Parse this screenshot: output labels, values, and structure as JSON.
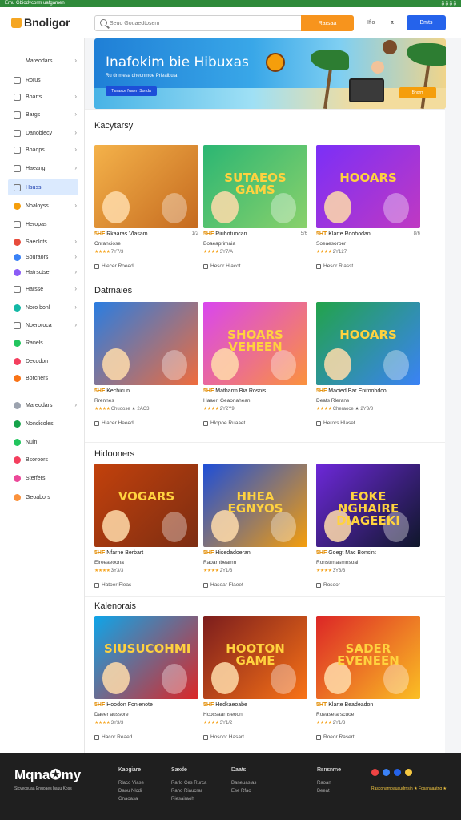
{
  "topstrip": {
    "left": "Emu Gbiodvcorm uafgamen",
    "right": "ᵹ ᵹ ᵹ ᵹ"
  },
  "header": {
    "logo": "Bnoligor",
    "search_placeholder": "Seuo Gouaedtosem",
    "search_button": "Rarsaa",
    "link_help": "Ifio",
    "link_bell": "ᴥ",
    "signin": "Bmts"
  },
  "sidebar": {
    "items": [
      {
        "label": "Mareodars",
        "icon": "none",
        "chev": "›"
      },
      {
        "label": "Rorus",
        "icon": "grid-icon",
        "chev": ""
      },
      {
        "label": "Boarts",
        "icon": "doc-icon",
        "chev": "›"
      },
      {
        "label": "Bargs",
        "icon": "tag-icon",
        "chev": "›"
      },
      {
        "label": "Danoblecy",
        "icon": "list-icon",
        "chev": "›"
      },
      {
        "label": "Boaops",
        "icon": "box-icon",
        "chev": "›"
      },
      {
        "label": "Haeang",
        "icon": "chart-icon",
        "chev": "›"
      },
      {
        "label": "Hsuss",
        "icon": "home-icon",
        "chev": "",
        "active": true
      },
      {
        "label": "Noaloyss",
        "icon": "puzzle-icon",
        "chev": "›"
      },
      {
        "label": "Heropas",
        "icon": "card-icon",
        "chev": ""
      },
      {
        "label": "Saeclots",
        "icon": "red-dot-icon",
        "chev": "›"
      },
      {
        "label": "Souraors",
        "icon": "blue-dot-icon",
        "chev": "›"
      },
      {
        "label": "Hatrsctse",
        "icon": "purple-dot-icon",
        "chev": "›"
      },
      {
        "label": "Harsse",
        "icon": "grid-icon",
        "chev": "›"
      },
      {
        "label": "Noro bonl",
        "icon": "globe-icon",
        "chev": "›"
      },
      {
        "label": "Noeroroca",
        "icon": "list-icon",
        "chev": "›"
      },
      {
        "label": "Ranels",
        "icon": "green-dot-icon",
        "chev": ""
      },
      {
        "label": "Decodon",
        "icon": "multi-icon",
        "chev": ""
      },
      {
        "label": "Borcners",
        "icon": "orange-dot-icon",
        "chev": ""
      },
      {
        "label": "Mareodars",
        "icon": "gray-dot-icon",
        "chev": "›"
      },
      {
        "label": "Nondicoles",
        "icon": "green-ring-icon",
        "chev": ""
      },
      {
        "label": "Nuin",
        "icon": "green-dot-icon",
        "chev": ""
      },
      {
        "label": "Bsoroors",
        "icon": "multi-icon",
        "chev": ""
      },
      {
        "label": "Sterfers",
        "icon": "pink-icon",
        "chev": ""
      },
      {
        "label": "Geoabors",
        "icon": "orange-square-icon",
        "chev": ""
      }
    ]
  },
  "hero": {
    "title": "Inafokim bie Hibuxas",
    "sub": "Ru dr mesa dheonmoe Prieaibuia",
    "btn": "Tanasce Naorn Sonda",
    "cta": "Bhorm"
  },
  "sections": [
    {
      "title": "Kacytarsy",
      "cards": [
        {
          "tag": "5HF",
          "title": "Rkaaras Vlasam",
          "meta": "1/2",
          "sub": "Cnranciose",
          "rating": "7Y7/3",
          "foot": "Hiecer Roeed",
          "big": "",
          "colors": [
            "#f4b24a",
            "#c56a1f"
          ]
        },
        {
          "tag": "5HF",
          "title": "Riuhotuocan",
          "meta": "5/6",
          "sub": "Boaeaprimaia",
          "rating": "3Y7/A",
          "foot": "Hesor Hlacot",
          "big": "SUTAEOS GAMS",
          "colors": [
            "#2bb673",
            "#8ad16b"
          ]
        },
        {
          "tag": "5HT",
          "title": "Klarte Roohodan",
          "meta": "8/6",
          "sub": "Soeaesoroer",
          "rating": "2Y127",
          "foot": "Hesor Rlasst",
          "big": "HOOARS",
          "colors": [
            "#7b2ff7",
            "#c039c2"
          ]
        }
      ]
    },
    {
      "title": "Datrnaies",
      "cards": [
        {
          "tag": "5HF",
          "title": "Kechicun",
          "meta": "",
          "sub": "Rrennes",
          "rating": "Chuoose ★ 2AC3",
          "foot": "Hiacer Heeed",
          "big": "",
          "colors": [
            "#2a7de1",
            "#f06c3c"
          ]
        },
        {
          "tag": "5HF",
          "title": "Matharm Bia Rosnis",
          "meta": "",
          "sub": "Haaerl Geaonahean",
          "rating": "2Y2Y9",
          "foot": "Hlopoe Ruaaet",
          "big": "SHOARS VEHEEN",
          "colors": [
            "#d946ef",
            "#fb923c"
          ]
        },
        {
          "tag": "5HF",
          "title": "Macied Bar Enifoohdco",
          "meta": "",
          "sub": "Deats Rlerans",
          "rating": "Cheraoce ★ 2Y3/3",
          "foot": "Herors Hlaset",
          "big": "HOOARS",
          "colors": [
            "#22a34a",
            "#3b82f6"
          ]
        }
      ]
    },
    {
      "title": "Hidooners",
      "cards": [
        {
          "tag": "5HF",
          "title": "Nfarne Berbart",
          "meta": "",
          "sub": "Elreeaeoona",
          "rating": "3Y3/3",
          "foot": "Hatoer Fleas",
          "big": "VOGARS",
          "colors": [
            "#c2410c",
            "#7c2d12"
          ]
        },
        {
          "tag": "5HF",
          "title": "Hisedadoeran",
          "meta": "",
          "sub": "Raoarnbeamn",
          "rating": "2Y1/3",
          "foot": "Hasear Flaeet",
          "big": "HHEA EGNYOS",
          "colors": [
            "#1d4ed8",
            "#f59e0b"
          ]
        },
        {
          "tag": "5HF",
          "title": "Goegt Mac Bonsint",
          "meta": "",
          "sub": "Ronstrmasmnsoal",
          "rating": "3Y3/3",
          "foot": "Rosoor",
          "big": "EOKE NGHAIRE DIAGEEKI",
          "colors": [
            "#6d28d9",
            "#0f172a"
          ]
        }
      ]
    },
    {
      "title": "Kalenorais",
      "cards": [
        {
          "tag": "5HF",
          "title": "Hoodon Fonlenote",
          "meta": "",
          "sub": "Daeer aussore",
          "rating": "3Y3/3",
          "foot": "Hacor Reaed",
          "big": "SIUSUCOHMI",
          "colors": [
            "#0ea5e9",
            "#dc2626"
          ]
        },
        {
          "tag": "5HF",
          "title": "Hedkaeoabe",
          "meta": "",
          "sub": "Hcocsaarnseoon",
          "rating": "3Y1/2",
          "foot": "Hosoor Hasart",
          "big": "HOOTON GAME",
          "colors": [
            "#7c1d1d",
            "#f97316"
          ]
        },
        {
          "tag": "5HT",
          "title": "Klarte Beadeadon",
          "meta": "",
          "sub": "Roeasetarscuoe",
          "rating": "2Y1/3",
          "foot": "Roeor Rasert",
          "big": "SADER EVENEEN",
          "colors": [
            "#dc2626",
            "#fbbf24"
          ]
        }
      ]
    }
  ],
  "footer": {
    "logo": "Mqna✪my",
    "tag": "Sicvecsuaa Enuoaes bauu Koss",
    "cols": [
      {
        "h": "Kaogiare",
        "links": [
          "Rlaco Viase",
          "Daou Nlcdi",
          "Gnaoasa"
        ]
      },
      {
        "h": "Saxde",
        "links": [
          "Rarlo Ces Rurca",
          "Rano Riaucrar",
          "Riesairaoh"
        ]
      },
      {
        "h": "Daats",
        "links": [
          "Baneuaslas",
          "Ese Rfao",
          ""
        ]
      },
      {
        "h": "Rsnsnrne",
        "links": [
          "Raoan",
          "Beeat",
          ""
        ]
      }
    ],
    "socials": [
      "#ef4444",
      "#3b82f6",
      "#2563eb",
      "#f5c842"
    ],
    "small": "Rasconarnoauaudrnsin ★ Fosanaaatng ★"
  }
}
